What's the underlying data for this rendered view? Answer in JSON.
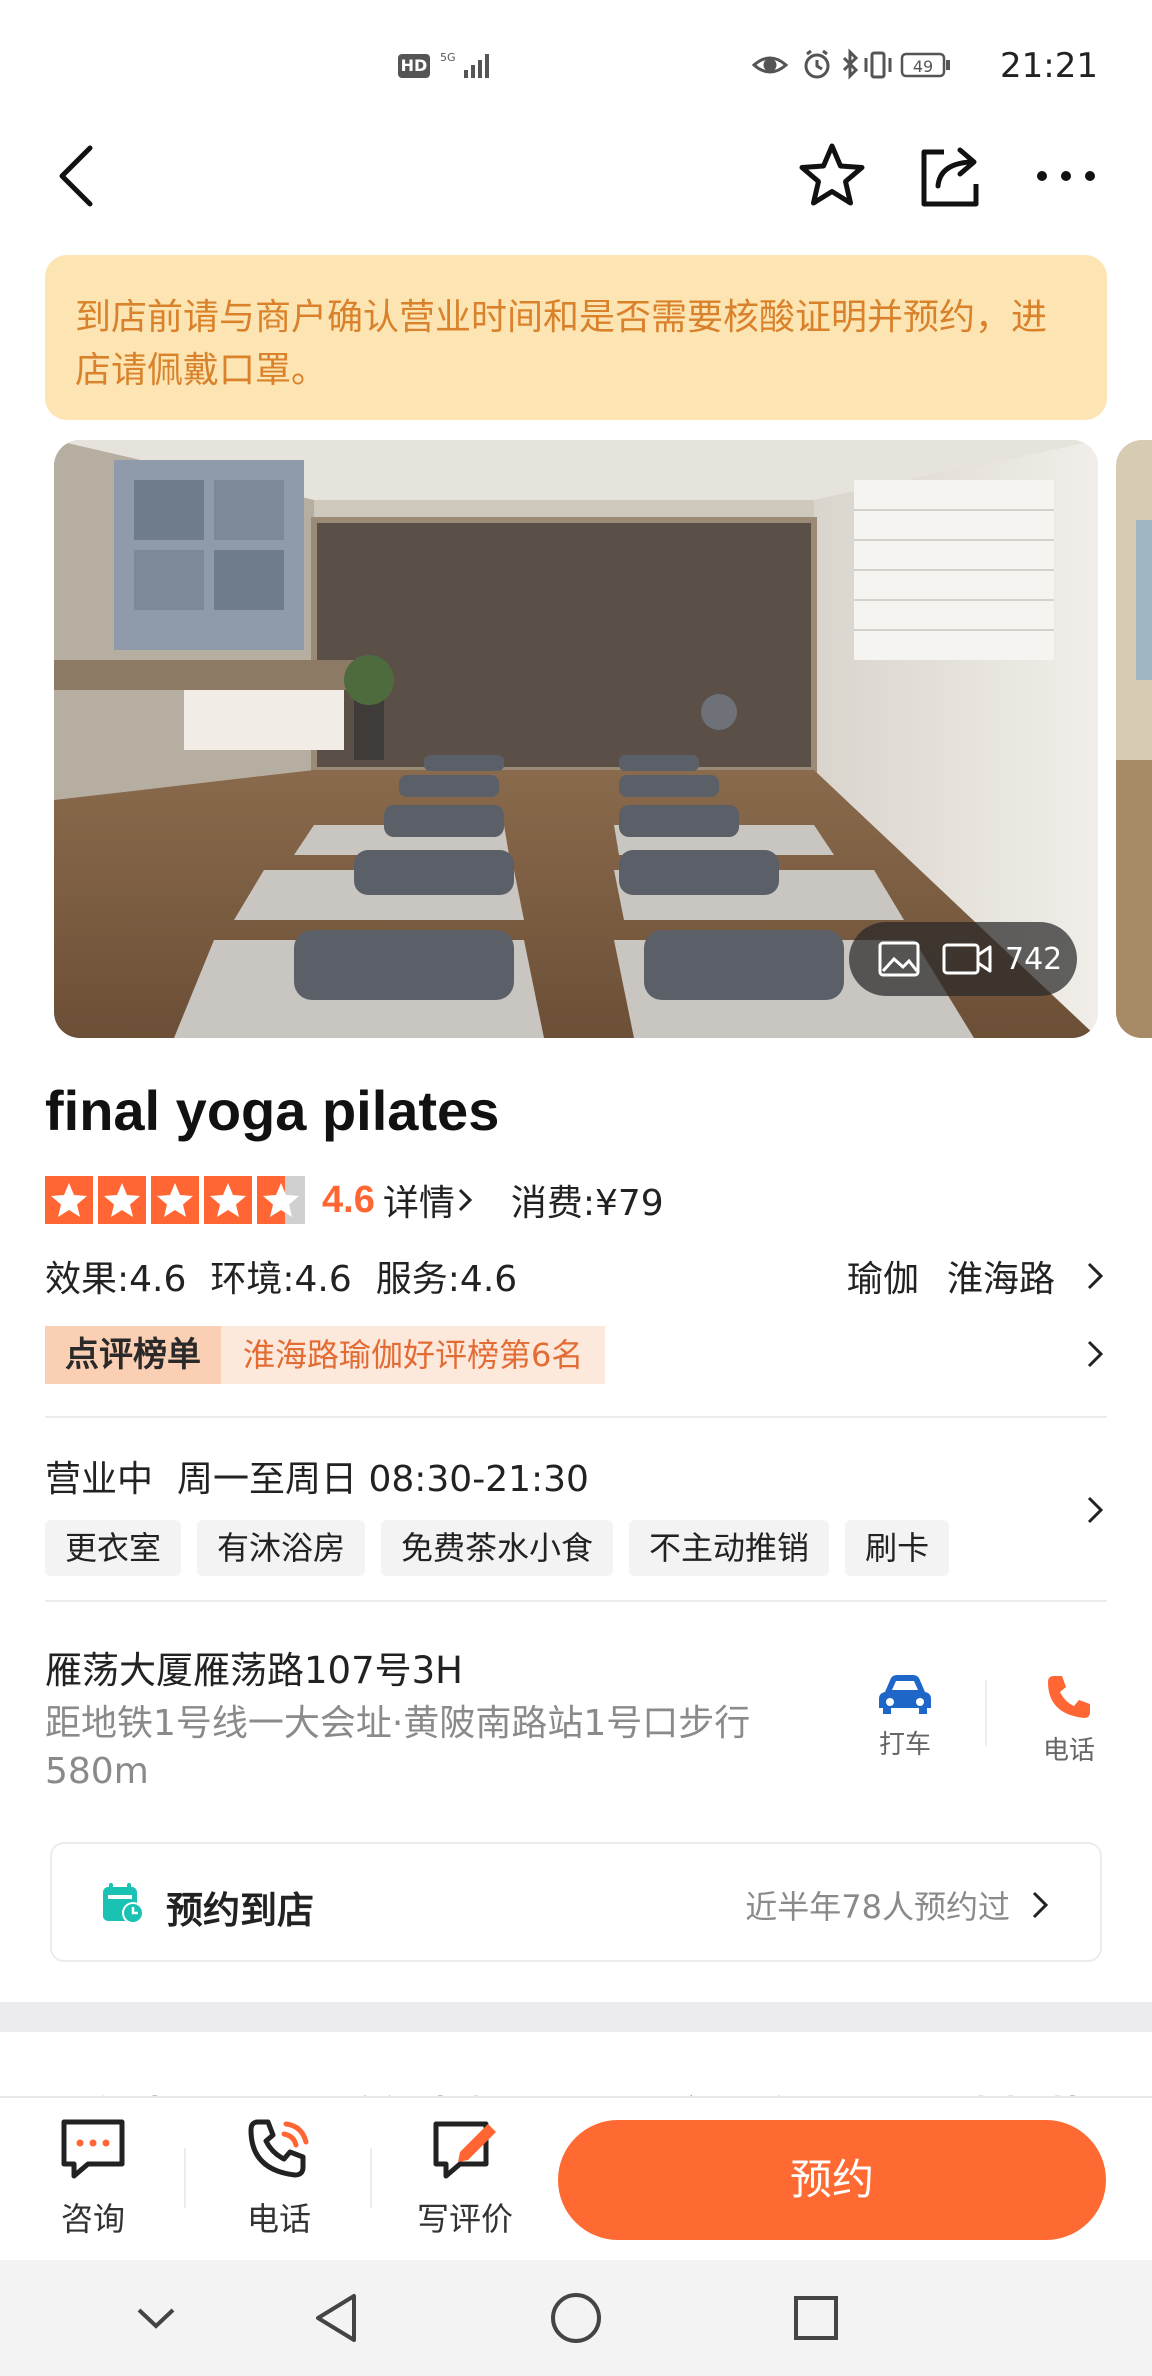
{
  "status_bar": {
    "time": "21:21",
    "hd_label": "HD",
    "network_label": "5G",
    "battery_level": "49"
  },
  "notice": {
    "text": "到店前请与商户确认营业时间和是否需要核酸证明并预约，进店请佩戴口罩。"
  },
  "gallery": {
    "media_count": "742"
  },
  "shop": {
    "name": "final yoga pilates",
    "rating": "4.6",
    "star_fill": 0.92,
    "details_label": "详情",
    "consumption": "消费:¥79",
    "scores": [
      "效果:4.6",
      "环境:4.6",
      "服务:4.6"
    ],
    "category": "瑜伽",
    "area": "淮海路",
    "rank_title": "点评榜单",
    "rank_text": "淮海路瑜伽好评榜第6名",
    "status": "营业中",
    "hours": "周一至周日 08:30-21:30",
    "tags": [
      "更衣室",
      "有沐浴房",
      "免费茶水小食",
      "不主动推销",
      "刷卡"
    ],
    "address": "雁荡大厦雁荡路107号3H",
    "metro": "距地铁1号线一大会址·黄陂南路站1号口步行580m",
    "taxi_label": "打车",
    "phone_label": "电话"
  },
  "booking": {
    "title": "预约到店",
    "meta": "近半年78人预约过"
  },
  "tabs_peek": [
    "优惠",
    "瑜伽老师",
    "用户评价",
    "同类推荐"
  ],
  "bottom_bar": {
    "consult_label": "咨询",
    "phone_label": "电话",
    "review_label": "写评价",
    "book_label": "预约"
  },
  "colors": {
    "accent": "#ff6a33",
    "rating": "#ff6633",
    "notice_bg": "#fde5b3",
    "notice_text": "#d9822b",
    "taxi_icon": "#1f66c9",
    "booking_icon": "#19c2b3"
  }
}
